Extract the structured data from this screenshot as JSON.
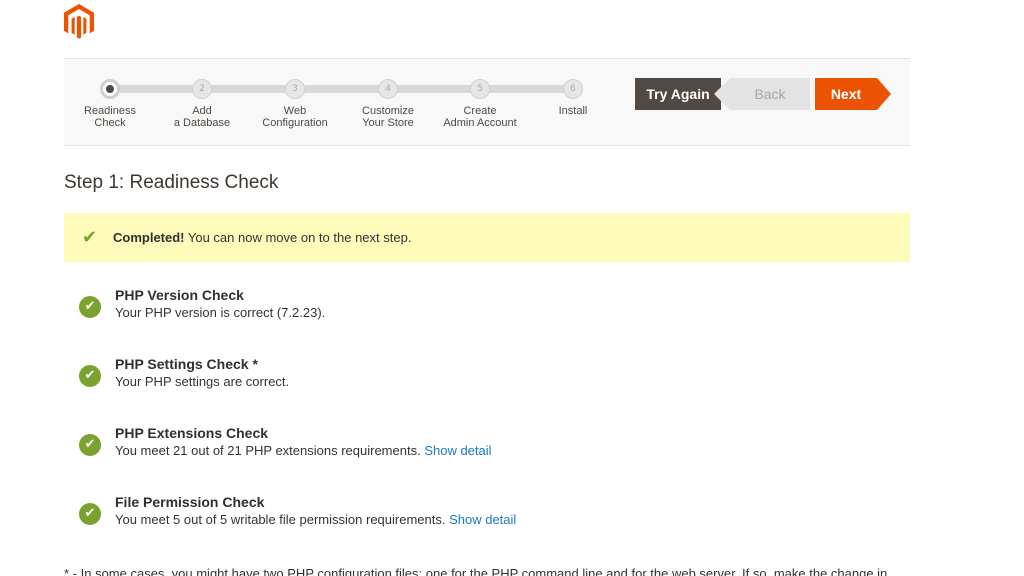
{
  "brand": {
    "logo_icon": "magento-logo-icon",
    "accent": "#eb5202"
  },
  "wizard": {
    "steps": [
      {
        "number": "",
        "line1": "Readiness",
        "line2": "Check",
        "active": true
      },
      {
        "number": "2",
        "line1": "Add",
        "line2": "a Database"
      },
      {
        "number": "3",
        "line1": "Web",
        "line2": "Configuration"
      },
      {
        "number": "4",
        "line1": "Customize",
        "line2": "Your Store"
      },
      {
        "number": "5",
        "line1": "Create",
        "line2": "Admin Account"
      },
      {
        "number": "6",
        "line1": "Install",
        "line2": ""
      }
    ],
    "buttons": {
      "try_again": "Try Again",
      "back": "Back",
      "next": "Next"
    }
  },
  "page_title": "Step 1: Readiness Check",
  "notice": {
    "strong": "Completed!",
    "text": " You can now move on to the next step.",
    "color": "#fffbbb"
  },
  "checks": [
    {
      "title": "PHP Version Check",
      "desc": "Your PHP version is correct (7.2.23).",
      "link": ""
    },
    {
      "title": "PHP Settings Check *",
      "desc": "Your PHP settings are correct.",
      "link": ""
    },
    {
      "title": "PHP Extensions Check",
      "desc": "You meet 21 out of 21 PHP extensions requirements. ",
      "link": "Show detail"
    },
    {
      "title": "File Permission Check",
      "desc": "You meet 5 out of 5 writable file permission requirements. ",
      "link": "Show detail"
    }
  ],
  "status_color": "#79a22e",
  "footnote": "* - In some cases, you might have two PHP configuration files: one for the PHP command line and for the web server. If so, make the change in"
}
